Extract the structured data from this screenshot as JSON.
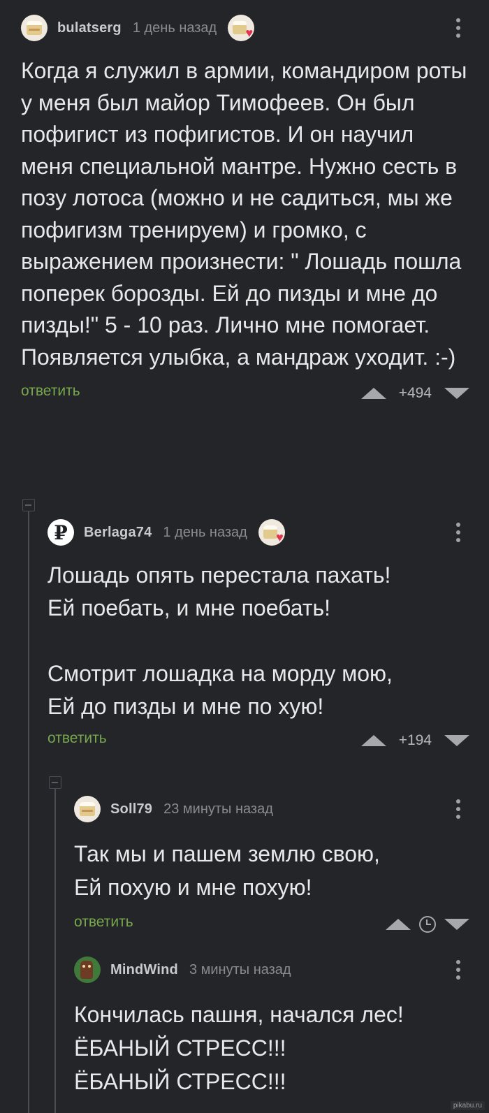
{
  "comments": [
    {
      "username": "bulatserg",
      "time": "1 день назад",
      "body": "Когда я служил в армии, командиром роты у меня был майор Тимофеев. Он был пофигист из пофигистов. И он научил меня специальной мантре. Нужно сесть в позу лотоса (можно и не садиться, мы же пофигизм тренируем) и громко, с выражением произнести: \" Лошадь пошла поперек борозды. Ей до пизды и мне до пизды!\" 5 - 10 раз. Лично мне помогает. Появляется улыбка, а мандраж уходит. :-)",
      "reply_label": "ответить",
      "score": "+494"
    },
    {
      "username": "Berlaga74",
      "time": "1 день назад",
      "avatar_glyph": "₽",
      "body": "Лошадь опять перестала пахать!\nЕй поебать, и мне поебать!\n\nСмотрит лошадка на морду мою,\nЕй до пизды и мне по хую!",
      "reply_label": "ответить",
      "score": "+194"
    },
    {
      "username": "Soll79",
      "time": "23 минуты назад",
      "body": "Так мы и пашем землю свою,\nЕй похую и мне похую!",
      "reply_label": "ответить"
    },
    {
      "username": "MindWind",
      "time": "3 минуты назад",
      "body": "Кончилась пашня, начался лес!\nЁБАНЫЙ СТРЕСС!!!\nЁБАНЫЙ СТРЕСС!!!"
    }
  ],
  "icons": {
    "upvote": "up-arrow-icon",
    "downvote": "down-arrow-icon",
    "pending_score": "clock-icon",
    "menu": "more-vertical-icon",
    "award": "cake-heart-award-icon"
  },
  "colors": {
    "background": "#232529",
    "reply_link": "#77a84d",
    "award_heart": "#e3344f"
  },
  "watermark": "pikabu.ru"
}
